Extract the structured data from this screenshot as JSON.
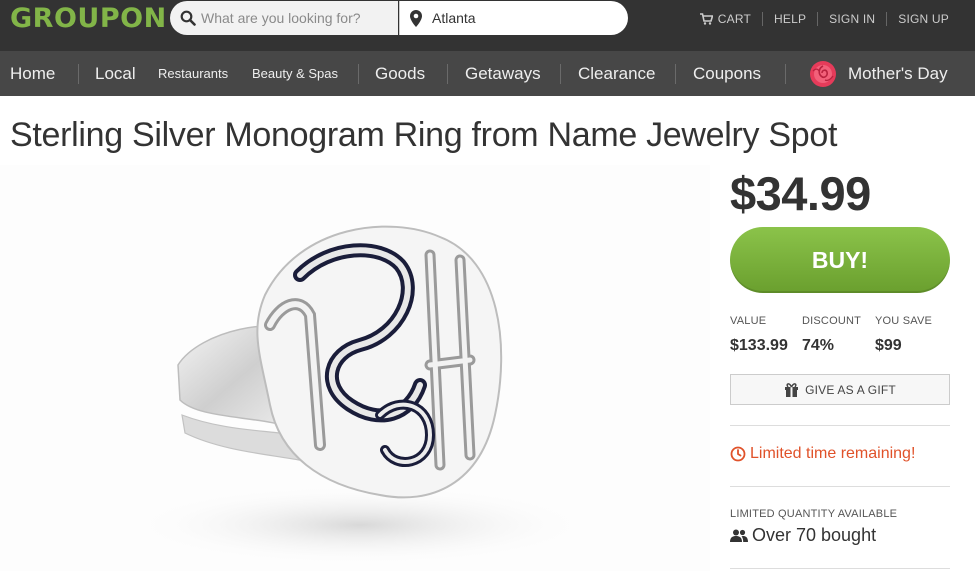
{
  "header": {
    "logo": "GROUPON",
    "search_placeholder": "What are you looking for?",
    "location": "Atlanta",
    "links": {
      "cart": "CART",
      "help": "HELP",
      "sign_in": "SIGN IN",
      "sign_up": "SIGN UP"
    }
  },
  "nav": {
    "items": [
      "Home",
      "Local",
      "Restaurants",
      "Beauty & Spas",
      "Goods",
      "Getaways",
      "Clearance",
      "Coupons",
      "Mother's Day"
    ]
  },
  "deal": {
    "title": "Sterling Silver Monogram Ring from Name Jewelry Spot",
    "price": "$34.99",
    "buy_label": "BUY!",
    "value_label": "VALUE",
    "value": "$133.99",
    "discount_label": "DISCOUNT",
    "discount": "74%",
    "you_save_label": "YOU SAVE",
    "you_save": "$99",
    "gift_label": "GIVE AS A GIFT",
    "limited_time": "Limited time remaining!",
    "limited_quantity_label": "LIMITED QUANTITY AVAILABLE",
    "bought": "Over 70 bought"
  },
  "colors": {
    "brand_green": "#82b548",
    "buy_button": "#7bb13c",
    "top_bar": "#333333",
    "nav_bar": "#474747",
    "urgent": "#e0522a"
  },
  "icons": [
    "search-icon",
    "location-pin-icon",
    "cart-icon",
    "rose-icon",
    "gift-icon",
    "clock-icon",
    "people-icon"
  ]
}
